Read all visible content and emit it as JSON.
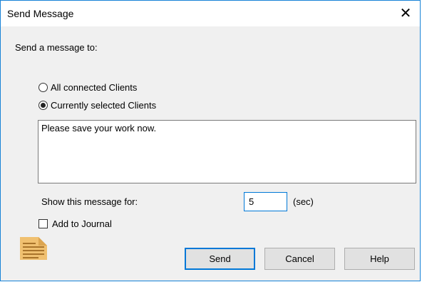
{
  "window": {
    "title": "Send Message",
    "close_glyph": "✕"
  },
  "prompt": "Send a message to:",
  "recipients": {
    "options": [
      {
        "label": "All connected Clients",
        "checked": false
      },
      {
        "label": "Currently selected Clients",
        "checked": true
      }
    ]
  },
  "message": {
    "text": "Please save your work now."
  },
  "duration": {
    "label": "Show this message for:",
    "value": "5",
    "unit": "(sec)"
  },
  "journal": {
    "label": "Add to Journal",
    "checked": false
  },
  "icon": {
    "name": "message-note-icon",
    "color": "#f0c070"
  },
  "buttons": {
    "send": "Send",
    "cancel": "Cancel",
    "help": "Help"
  },
  "colors": {
    "accent": "#0078d7",
    "border": "#1883d7"
  }
}
